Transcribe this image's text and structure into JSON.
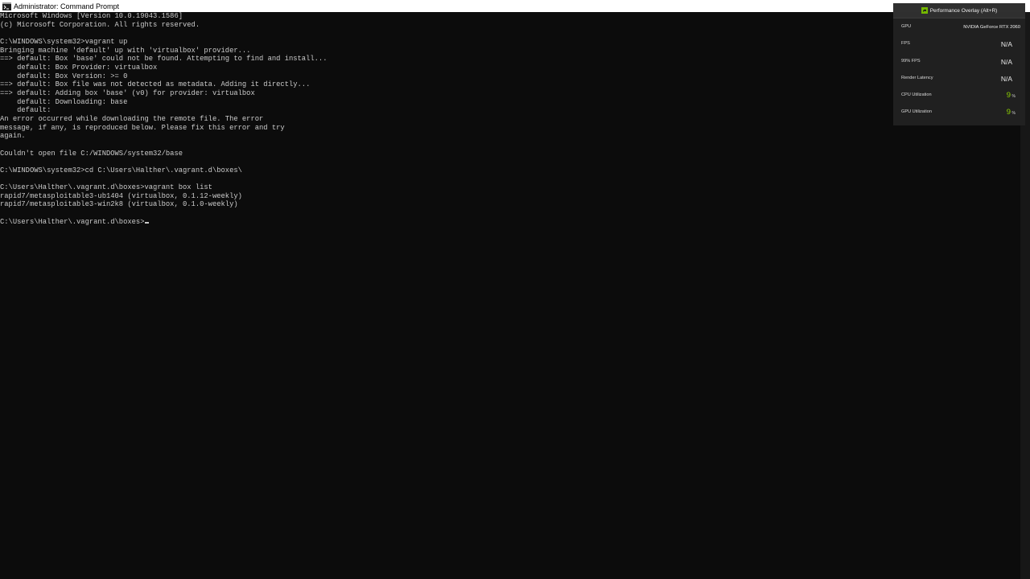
{
  "window": {
    "title": "Administrator: Command Prompt",
    "icon": "cmd-icon"
  },
  "console": {
    "lines": [
      "Microsoft Windows [Version 10.0.19043.1586]",
      "(c) Microsoft Corporation. All rights reserved.",
      "",
      "C:\\WINDOWS\\system32>vagrant up",
      "Bringing machine 'default' up with 'virtualbox' provider...",
      "==> default: Box 'base' could not be found. Attempting to find and install...",
      "    default: Box Provider: virtualbox",
      "    default: Box Version: >= 0",
      "==> default: Box file was not detected as metadata. Adding it directly...",
      "==> default: Adding box 'base' (v0) for provider: virtualbox",
      "    default: Downloading: base",
      "    default:",
      "An error occurred while downloading the remote file. The error",
      "message, if any, is reproduced below. Please fix this error and try",
      "again.",
      "",
      "Couldn't open file C:/WINDOWS/system32/base",
      "",
      "C:\\WINDOWS\\system32>cd C:\\Users\\Halther\\.vagrant.d\\boxes\\",
      "",
      "C:\\Users\\Halther\\.vagrant.d\\boxes>vagrant box list",
      "rapid7/metasploitable3-ub1404 (virtualbox, 0.1.12-weekly)",
      "rapid7/metasploitable3-win2k8 (virtualbox, 0.1.0-weekly)",
      ""
    ],
    "prompt": "C:\\Users\\Halther\\.vagrant.d\\boxes>"
  },
  "overlay": {
    "title": "Performance Overlay (Alt+R)",
    "logo": "nvidia-logo-icon",
    "accent_color": "#8ed100",
    "rows": {
      "gpu": {
        "label": "GPU",
        "value": "NVIDIA GeForce RTX 2060"
      },
      "fps": {
        "label": "FPS",
        "value": "N/A"
      },
      "fps99": {
        "label": "99% FPS",
        "value": "N/A"
      },
      "latency": {
        "label": "Render Latency",
        "value": "N/A"
      },
      "cpu": {
        "label": "CPU Utilization",
        "value": "9",
        "unit": "%"
      },
      "gpu_util": {
        "label": "GPU Utilization",
        "value": "9",
        "unit": "%"
      }
    }
  }
}
